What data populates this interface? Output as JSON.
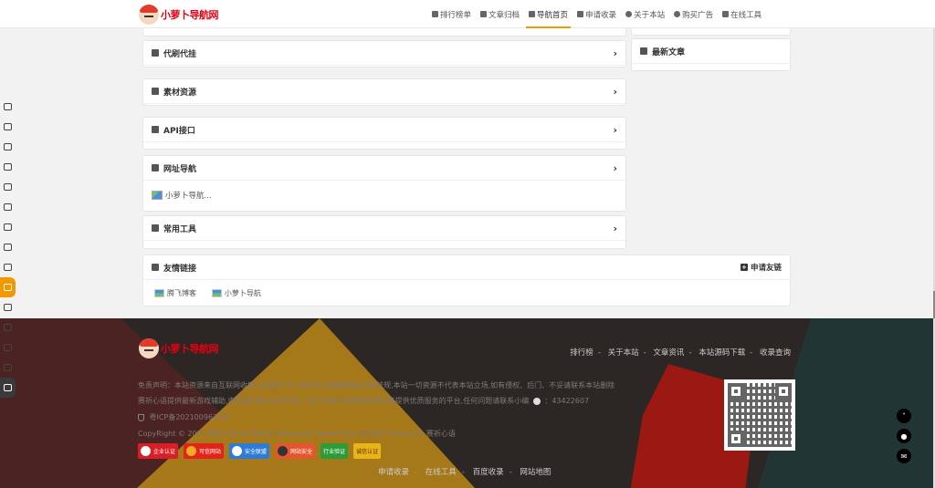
{
  "header": {
    "logo_text": "小萝卜导航网",
    "nav": [
      {
        "label": "排行榜单",
        "icon": "chart-icon"
      },
      {
        "label": "文章归档",
        "icon": "archive-icon"
      },
      {
        "label": "导航首页",
        "icon": "home-icon",
        "active": true
      },
      {
        "label": "申请收录",
        "icon": "plus-square-icon"
      },
      {
        "label": "关于本站",
        "icon": "info-icon"
      },
      {
        "label": "购买广告",
        "icon": "info-icon"
      },
      {
        "label": "在线工具",
        "icon": "grid-icon"
      }
    ]
  },
  "left_toolbar": [
    "thumbs-up-icon",
    "book-icon",
    "file-icon",
    "cloud-download-icon",
    "download-icon",
    "monitor-icon",
    "edit-icon",
    "music-icon",
    "android-icon",
    "card-icon",
    "bag-icon",
    "image-icon",
    "refresh-icon",
    "send-icon",
    "leaf-icon"
  ],
  "sections": {
    "daishua": {
      "title": "代刷代挂"
    },
    "sucai": {
      "title": "素材资源"
    },
    "api": {
      "title": "API接口"
    },
    "wangzhi": {
      "title": "网址导航",
      "site": "小萝卜导航..."
    },
    "tools": {
      "title": "常用工具"
    }
  },
  "latest": {
    "title": "最新文章"
  },
  "friends": {
    "title": "友情链接",
    "apply": "申请友链",
    "links": [
      "腾飞博客",
      "小萝卜导航"
    ]
  },
  "footer": {
    "logo_text": "小萝卜导航网",
    "links": [
      "排行榜",
      "关于本站",
      "文章资讯",
      "本站源码下载",
      "收录查询"
    ],
    "disclaimer": "免责声明：本站资源来自互联网收集,仅供用于学习和交流,请遵循相关法律法规,本站一切资源不代表本站立场,如有侵权、后门、不妥请联系本站删除",
    "about": "赛祈心语提供最新游戏辅助,电影抢先看,QQ软件等。努力打造为全国网络爱好者提供优质服务的平台,任何问题请联系小编",
    "qq": "43422607",
    "icp": "粤ICP备2021009638号",
    "copyright": "CopyRight © 2021 赛祈心语 All Rights Reserved. Powered by DHCAT Theme by 赛祈心语",
    "badges": [
      "企业认证",
      "可信网站",
      "安全联盟",
      "网站安全",
      "行业验证",
      "诚信认证"
    ],
    "bottom_links": [
      "申请收录",
      "在线工具",
      "百度收录",
      "网站地图"
    ]
  },
  "colors": {
    "accent": "#f39800",
    "footer_bg": "#2c2624"
  }
}
